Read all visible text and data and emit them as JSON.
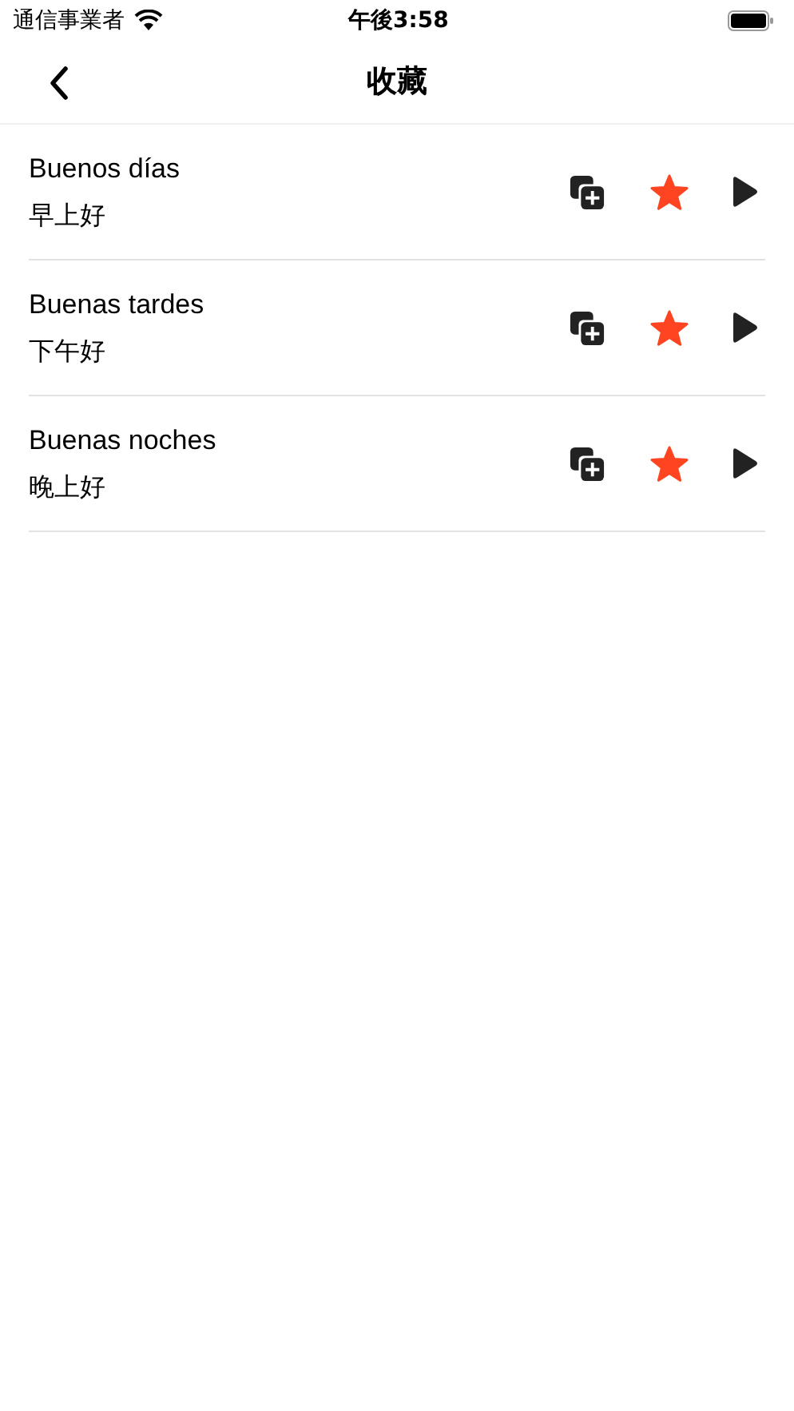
{
  "status_bar": {
    "carrier": "通信事業者",
    "time": "午後3:58"
  },
  "nav": {
    "title": "收藏"
  },
  "items": [
    {
      "phrase": "Buenos días",
      "translation": "早上好",
      "favorite": true
    },
    {
      "phrase": "Buenas tardes",
      "translation": "下午好",
      "favorite": true
    },
    {
      "phrase": "Buenas noches",
      "translation": "晚上好",
      "favorite": true
    }
  ]
}
